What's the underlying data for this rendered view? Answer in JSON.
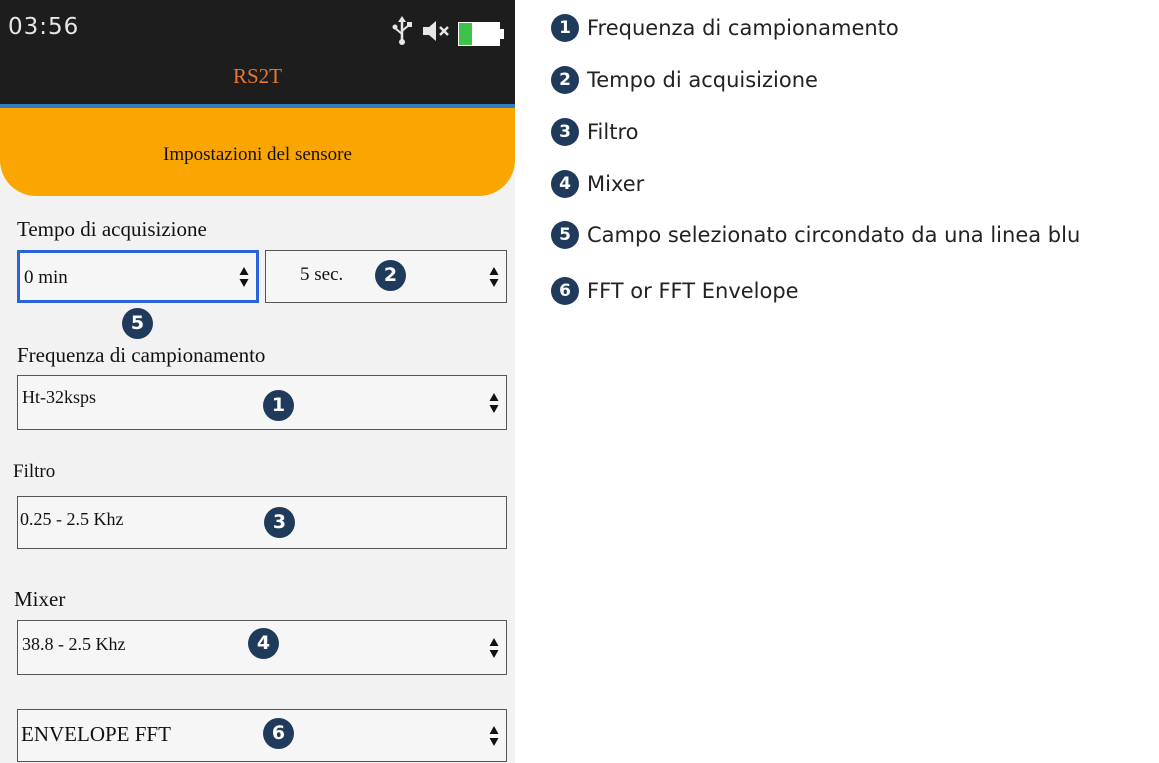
{
  "status_bar": {
    "time": "03:56",
    "icons": [
      "usb-icon",
      "mute-icon",
      "battery-icon"
    ],
    "battery_color": "#3fc24a"
  },
  "app": {
    "title": "RS2T",
    "title_color": "#e8782f"
  },
  "header": {
    "title": "Impostazioni del sensore",
    "color": "#fba500"
  },
  "form": {
    "acquisition_time": {
      "label": "Tempo di acquisizione",
      "minutes": "0 min",
      "seconds": "5 sec."
    },
    "sampling_frequency": {
      "label": "Frequenza di campionamento",
      "value": "Ht-32ksps"
    },
    "filter": {
      "label": "Filtro",
      "value": "0.25 - 2.5 Khz"
    },
    "mixer": {
      "label": "Mixer",
      "value": "38.8 - 2.5 Khz"
    },
    "fft_mode": {
      "value": "ENVELOPE FFT"
    },
    "selected_border_color": "#2a64d8"
  },
  "badges": {
    "b1": "1",
    "b2": "2",
    "b3": "3",
    "b4": "4",
    "b5": "5",
    "b6": "6"
  },
  "legend": [
    {
      "num": "1",
      "text": "Frequenza di campionamento"
    },
    {
      "num": "2",
      "text": "Tempo di acquisizione"
    },
    {
      "num": "3",
      "text": "Filtro"
    },
    {
      "num": "4",
      "text": "Mixer"
    },
    {
      "num": "5",
      "text": "Campo selezionato circondato da una linea blu"
    },
    {
      "num": "6",
      "text": "FFT or FFT Envelope"
    }
  ]
}
